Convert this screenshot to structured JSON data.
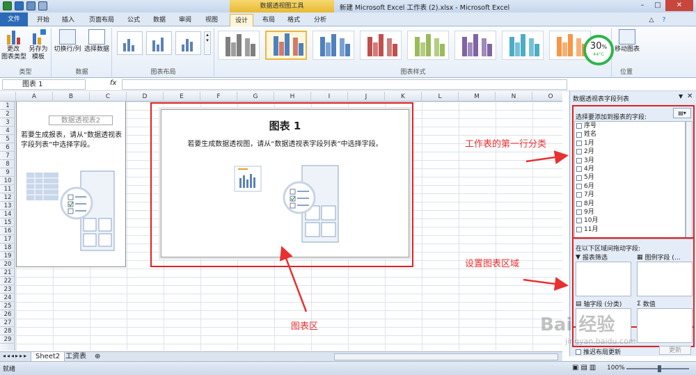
{
  "window": {
    "context_tool_title": "数据透视图工具",
    "title": "新建 Microsoft Excel 工作表 (2).xlsx - Microsoft Excel"
  },
  "tabs": [
    "文件",
    "开始",
    "插入",
    "页面布局",
    "公式",
    "数据",
    "审阅",
    "视图",
    "设计",
    "布局",
    "格式",
    "分析"
  ],
  "active_tab": "设计",
  "ribbon": {
    "type_group": {
      "change_type": "更改\n图表类型",
      "save_template": "另存为\n模板",
      "label": "类型"
    },
    "data_group": {
      "switch": "切换行/列",
      "select": "选择数据",
      "label": "数据"
    },
    "layout_group": {
      "label": "图表布局"
    },
    "styles_group": {
      "label": "图表样式"
    },
    "location_group": {
      "move": "移动图表",
      "label": "位置"
    },
    "perf_widget": {
      "percent": "30",
      "unit": "%",
      "temp": "44°C"
    },
    "style_colors": [
      "#7f7f7f",
      "#4f81bd",
      "#4f81bd",
      "#c0504d",
      "#9bbb59",
      "#8064a2",
      "#4bacc6",
      "#f79646"
    ]
  },
  "formula_bar": {
    "name_box": "图表 1",
    "fx": "fx",
    "value": ""
  },
  "grid": {
    "columns": [
      "A",
      "B",
      "C",
      "D",
      "E",
      "F",
      "G",
      "H",
      "I",
      "J",
      "K",
      "L",
      "M",
      "N",
      "O"
    ],
    "rows": [
      "1",
      "2",
      "3",
      "4",
      "5",
      "6",
      "7",
      "8",
      "9",
      "10",
      "11",
      "12",
      "13",
      "14",
      "15",
      "16",
      "17",
      "18",
      "19",
      "20",
      "21",
      "22",
      "23",
      "24",
      "25",
      "26",
      "27",
      "28",
      "29"
    ]
  },
  "pivot_placeholder": {
    "title": "数据透视表2",
    "message": "若要生成报表，请从“数据透视表字段列表”中选择字段。"
  },
  "chart": {
    "title": "图表 1",
    "message": "若要生成数据透视图，请从“数据透视表字段列表”中选择字段。"
  },
  "field_pane": {
    "title": "数据透视表字段列表",
    "choose_label": "选择要添加到报表的字段:",
    "fields": [
      "序号",
      "姓名",
      "1月",
      "2月",
      "3月",
      "4月",
      "5月",
      "6月",
      "7月",
      "8月",
      "9月",
      "10月",
      "11月"
    ],
    "drag_label": "在以下区域间拖动字段:",
    "zones": {
      "filter": "报表筛选",
      "legend": "图例字段 (…",
      "axis": "轴字段 (分类)",
      "values": "数值"
    },
    "defer": "推迟布局更新",
    "update": "更新"
  },
  "annotations": {
    "fields_note": "工作表的第一行分类",
    "zones_note": "设置图表区域",
    "chart_note": "图表区"
  },
  "sheet_tabs": [
    "Sheet2",
    "工资表"
  ],
  "status": {
    "ready": "就绪",
    "zoom": "100%"
  },
  "watermark": {
    "brand": "Bai 经验",
    "url": "jingyan.baidu.com"
  }
}
